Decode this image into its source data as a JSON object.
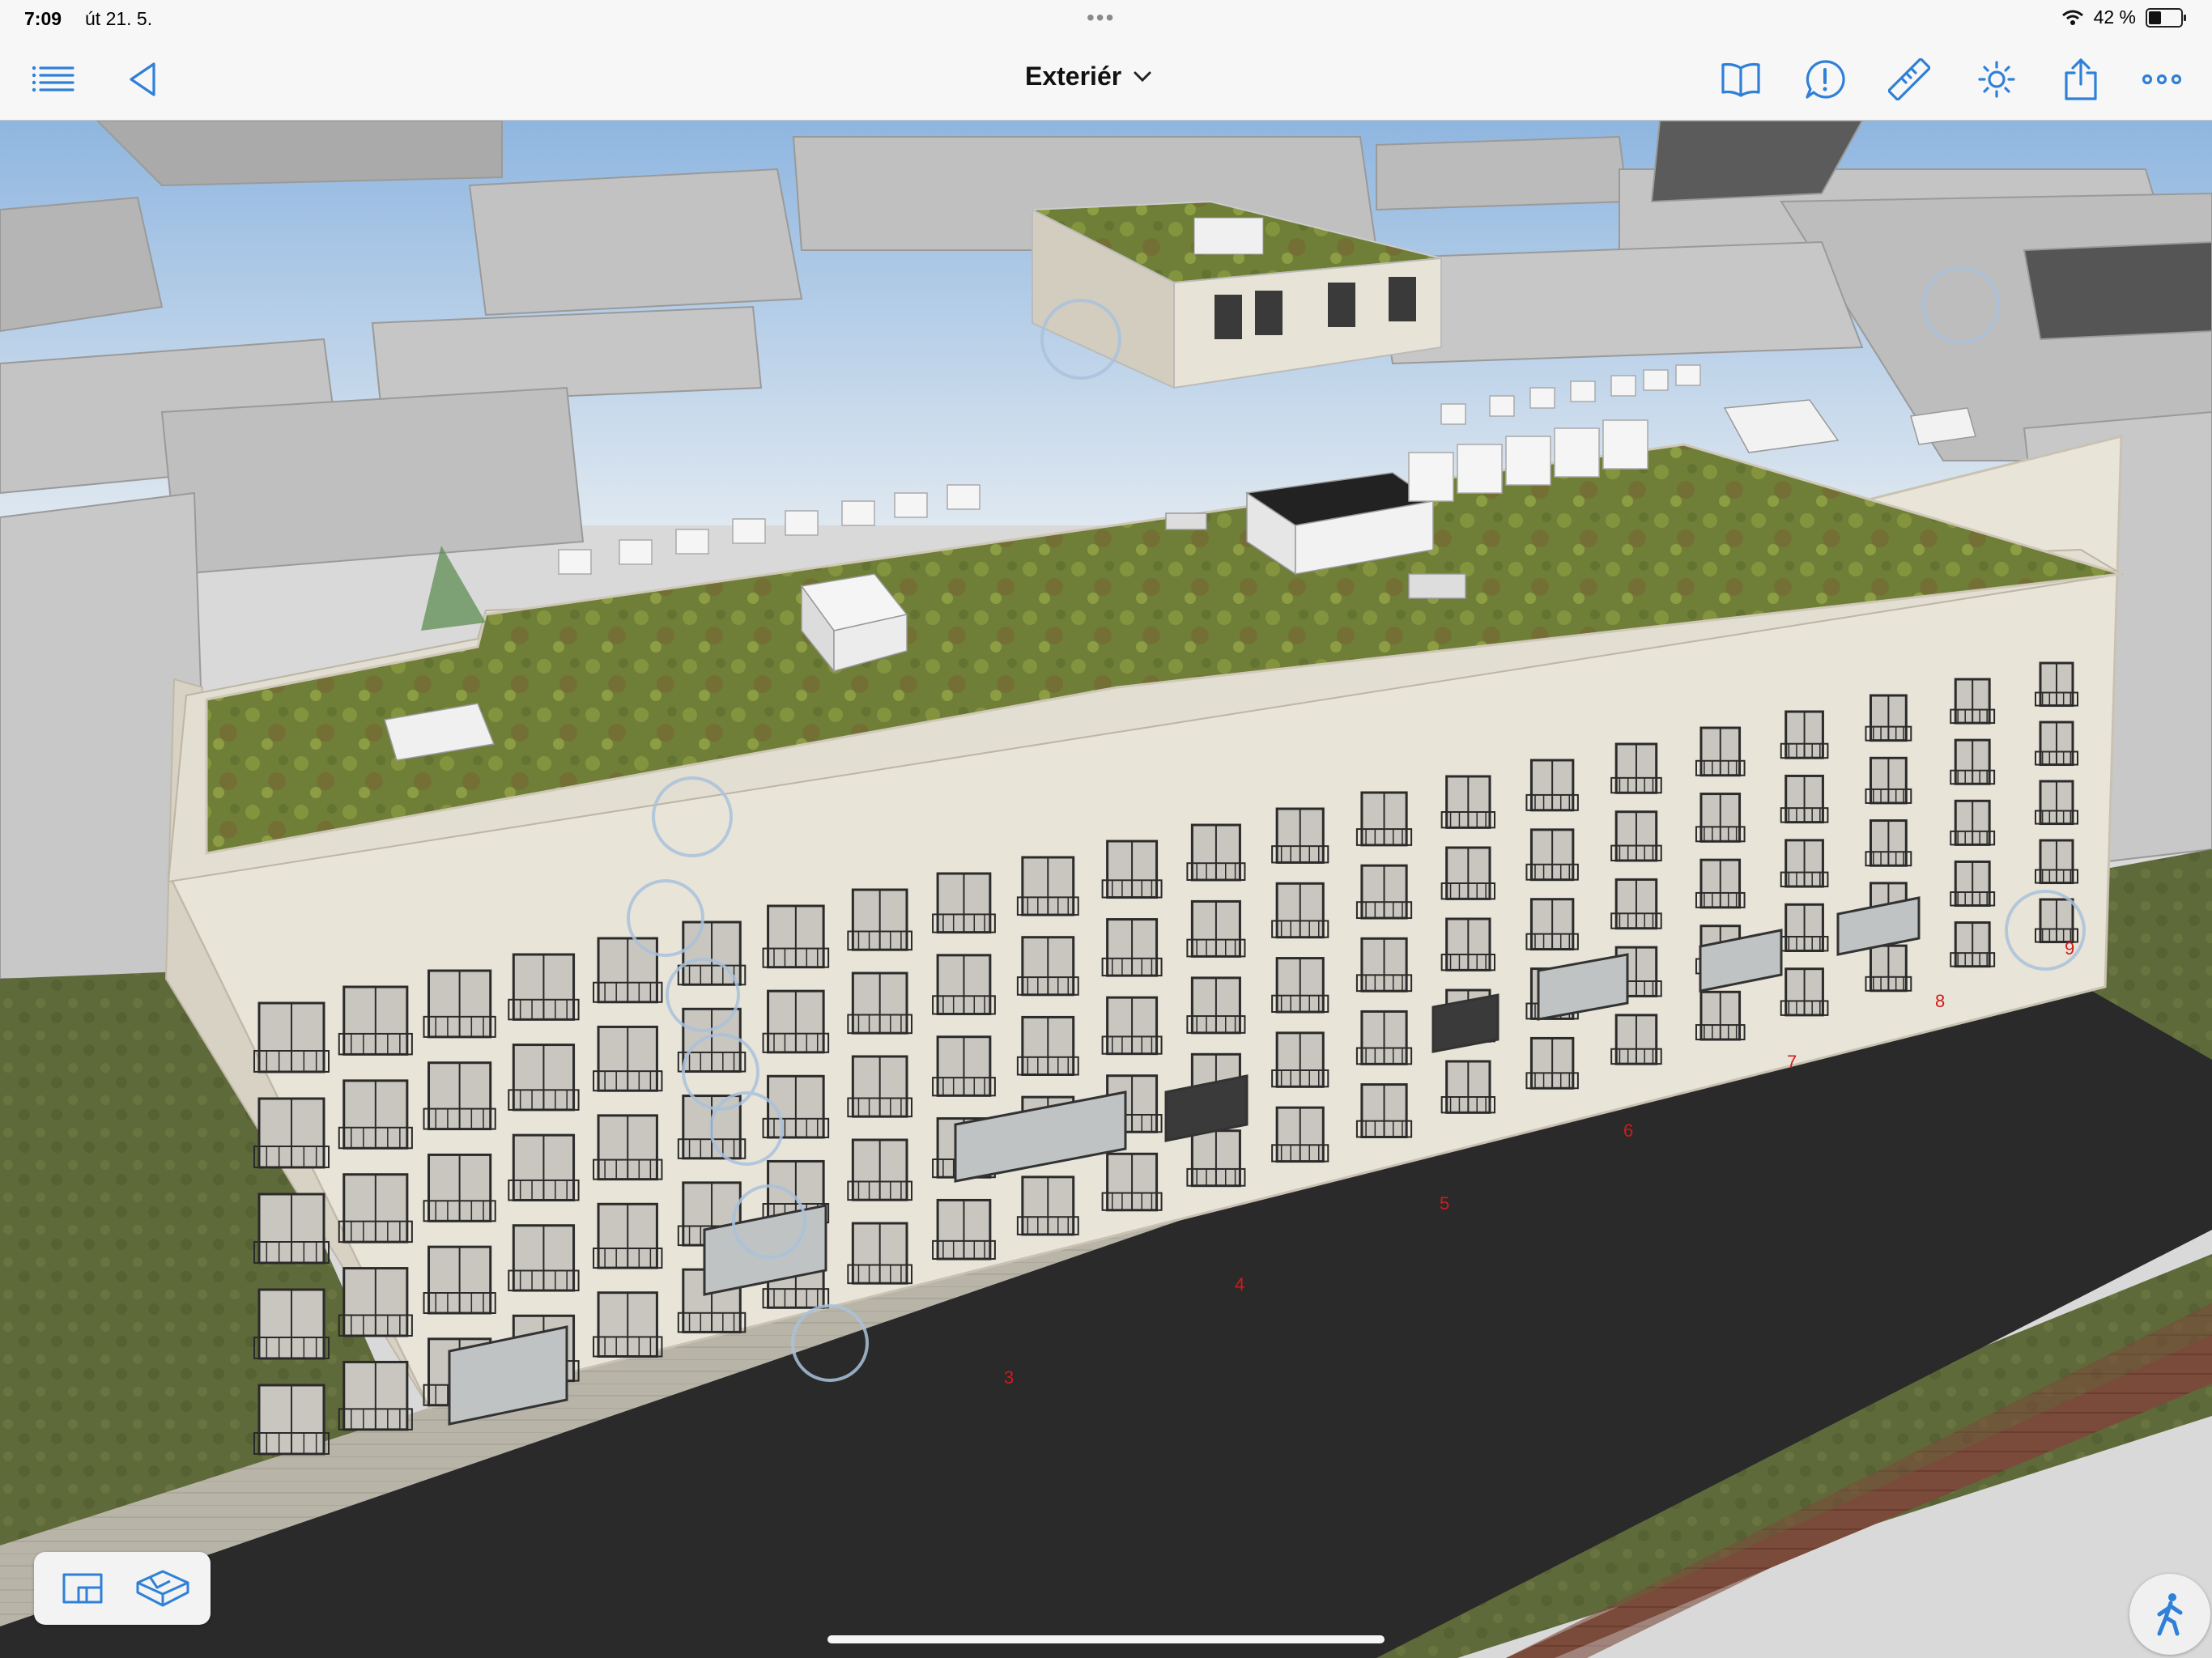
{
  "status_bar": {
    "time": "7:09",
    "date": "út 21. 5.",
    "battery_percent": "42 %",
    "battery_level": 0.42
  },
  "toolbar": {
    "title": "Exteriér",
    "left_icons": [
      "list-icon",
      "back-icon"
    ],
    "right_icons": [
      "book-icon",
      "issue-icon",
      "ruler-icon",
      "sun-icon",
      "share-icon",
      "more-icon"
    ]
  },
  "viewport": {
    "street_markers": [
      "3",
      "4",
      "5",
      "6",
      "7",
      "8",
      "9"
    ]
  },
  "bottom_controls": {
    "view_modes": [
      "2d-plan-icon",
      "3d-view-icon"
    ],
    "walk": "walk-icon"
  },
  "colors": {
    "accent": "#2f80d8",
    "marker": "#d21a1a",
    "roof": "#7d8a35",
    "road": "#2a2a2a"
  }
}
